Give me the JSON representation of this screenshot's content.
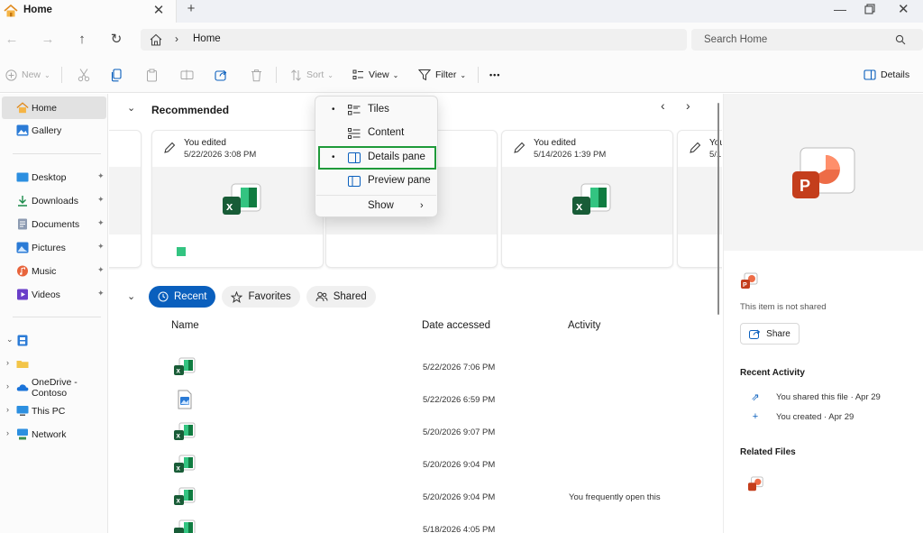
{
  "window": {
    "tab_title": "Home",
    "tab_close": "✕",
    "new_tab": "+",
    "minimize": "—",
    "close": "✕"
  },
  "address": {
    "back": "←",
    "forward": "→",
    "up": "↑",
    "refresh": "↻",
    "separator": "›",
    "path": "Home",
    "search_placeholder": "Search Home"
  },
  "commands": {
    "new": "New",
    "sort": "Sort",
    "view": "View",
    "filter": "Filter",
    "more": "•••",
    "details": "Details"
  },
  "sidebar": {
    "items": [
      {
        "label": "Home",
        "icon": "home-icon"
      },
      {
        "label": "Gallery",
        "icon": "gallery-icon"
      },
      {
        "label": "Desktop",
        "icon": "desktop-icon",
        "pinned": true
      },
      {
        "label": "Downloads",
        "icon": "download-icon",
        "pinned": true
      },
      {
        "label": "Documents",
        "icon": "documents-icon",
        "pinned": true
      },
      {
        "label": "Pictures",
        "icon": "pictures-icon",
        "pinned": true
      },
      {
        "label": "Music",
        "icon": "music-icon",
        "pinned": true
      },
      {
        "label": "Videos",
        "icon": "videos-icon",
        "pinned": true
      },
      {
        "label": "OneDrive - Contoso",
        "icon": "onedrive-icon"
      },
      {
        "label": "This PC",
        "icon": "this-pc-icon"
      },
      {
        "label": "Network",
        "icon": "network-icon"
      }
    ],
    "pin_glyph": "📌"
  },
  "recommended": {
    "title": "Recommended",
    "prev": "‹",
    "next": "›",
    "cards": [
      {
        "edited": "You edited",
        "date": "5/22/2026 3:08 PM",
        "icon": "excel-icon"
      },
      {
        "edited": "You edited",
        "date": "5/14/2026 1:39 PM",
        "icon": "excel-icon"
      },
      {
        "edited": "You",
        "date": "5/1",
        "icon": "file-icon"
      }
    ]
  },
  "filters": {
    "recent": "Recent",
    "favorites": "Favorites",
    "shared": "Shared"
  },
  "table": {
    "columns": [
      "Name",
      "Date accessed",
      "Activity"
    ],
    "rows": [
      {
        "icon": "excel-icon",
        "date": "5/22/2026 7:06 PM",
        "activity": ""
      },
      {
        "icon": "image-icon",
        "date": "5/22/2026 6:59 PM",
        "activity": ""
      },
      {
        "icon": "excel-icon",
        "date": "5/20/2026 9:07 PM",
        "activity": ""
      },
      {
        "icon": "excel-icon",
        "date": "5/20/2026 9:04 PM",
        "activity": ""
      },
      {
        "icon": "excel-icon",
        "date": "5/20/2026 9:04 PM",
        "activity": "You frequently open this"
      },
      {
        "icon": "excel-icon",
        "date": "5/18/2026 4:05 PM",
        "activity": ""
      }
    ]
  },
  "view_menu": {
    "items": [
      {
        "label": "Tiles",
        "bullet": "•",
        "icon": "tiles-icon"
      },
      {
        "label": "Content",
        "bullet": "",
        "icon": "content-icon"
      },
      {
        "label": "Details pane",
        "bullet": "•",
        "icon": "details-pane-icon",
        "highlighted": true
      },
      {
        "label": "Preview pane",
        "bullet": "",
        "icon": "preview-pane-icon"
      },
      {
        "label": "Show",
        "bullet": "",
        "icon": "",
        "submenu": "›"
      }
    ]
  },
  "details_pane": {
    "not_shared": "This item is not shared",
    "share_button": "Share",
    "recent_activity_title": "Recent Activity",
    "activities": [
      {
        "text": "You shared this file · Apr 29",
        "icon": "share-icon"
      },
      {
        "text": "You created · Apr 29",
        "icon": "plus-icon"
      }
    ],
    "related_files_title": "Related Files"
  },
  "colors": {
    "accent": "#0a5fbd",
    "highlight_outline": "#1f9a3a",
    "excel_green": "#21a366",
    "powerpoint_red": "#c43e1c"
  }
}
